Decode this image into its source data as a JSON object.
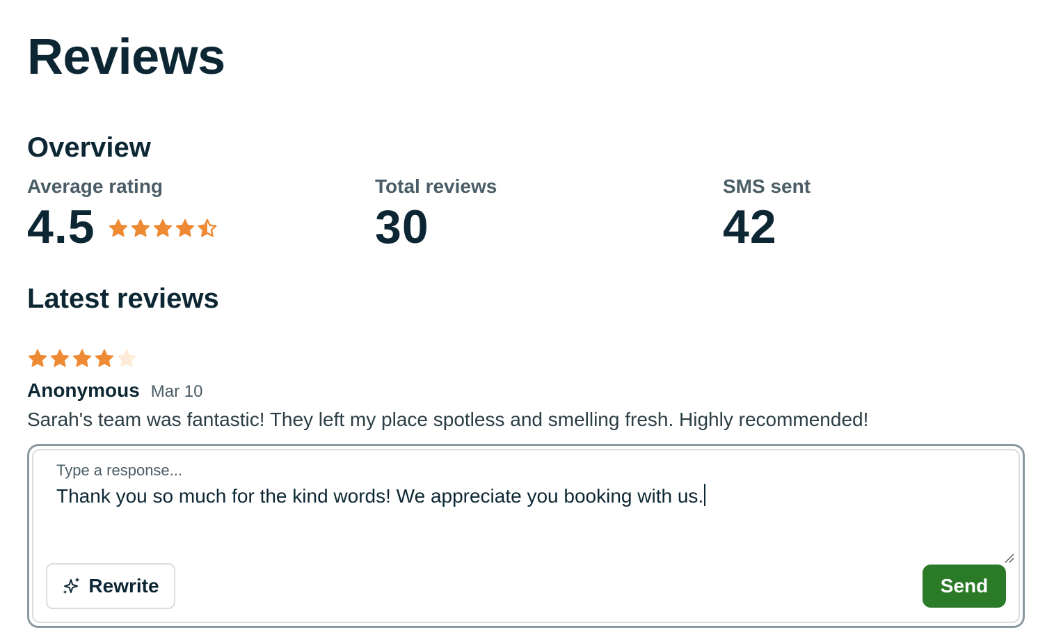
{
  "page": {
    "title": "Reviews"
  },
  "overview": {
    "heading": "Overview",
    "average_rating": {
      "label": "Average rating",
      "value": "4.5",
      "stars": 4.5
    },
    "total_reviews": {
      "label": "Total reviews",
      "value": "30"
    },
    "sms_sent": {
      "label": "SMS sent",
      "value": "42"
    }
  },
  "latest": {
    "heading": "Latest reviews",
    "review": {
      "rating": 4,
      "max_rating": 5,
      "author": "Anonymous",
      "date": "Mar 10",
      "text": "Sarah's team was fantastic! They left my place spotless and smelling fresh. Highly recommended!"
    }
  },
  "response": {
    "label": "Type a response...",
    "value": "Thank you so much for the kind words! We appreciate you booking with us.",
    "rewrite_label": "Rewrite",
    "send_label": "Send"
  },
  "colors": {
    "star_filled": "#ef8a34",
    "star_empty": "#fdebd8",
    "send": "#2b7a28",
    "text_dark": "#0c2733",
    "text_muted": "#4a5d66"
  },
  "icons": {
    "star": "star-icon",
    "half_star": "half-star-icon",
    "rewrite": "sparkles-icon",
    "resize": "resize-grip-icon"
  }
}
